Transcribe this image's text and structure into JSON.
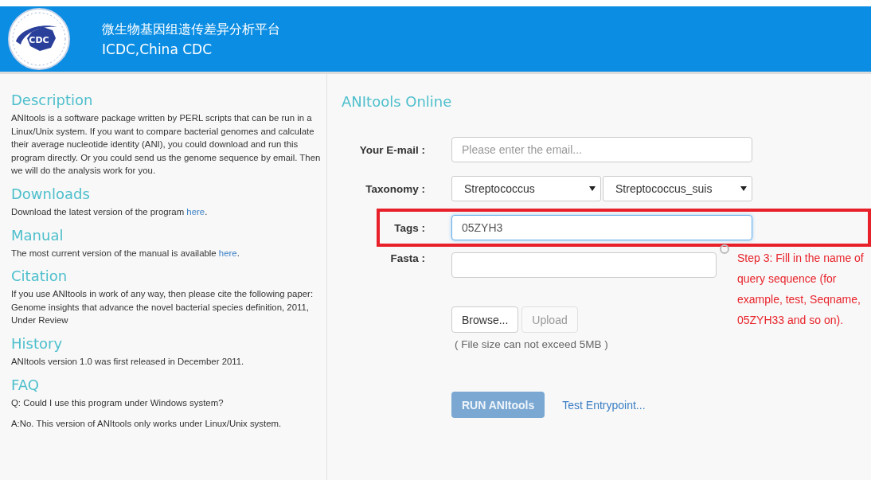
{
  "header": {
    "logo_text": "CDC",
    "title": "微生物基因组遗传差异分析平台",
    "subtitle": "ICDC,China CDC"
  },
  "sidebar": {
    "sections": [
      {
        "heading": "Description",
        "paragraphs": [
          {
            "text": "ANItools is a software package written by PERL scripts that can be run in a Linux/Unix system. If you want to compare bacterial genomes and calculate their average nucleotide identity (ANI), you could download and run this program directly. Or you could send us the genome sequence by email. Then we will do the analysis work for you."
          }
        ]
      },
      {
        "heading": "Downloads",
        "paragraphs": [
          {
            "text": "Download the latest version of the program ",
            "link": "here",
            "after": "."
          }
        ]
      },
      {
        "heading": "Manual",
        "paragraphs": [
          {
            "text": "The most current version of the manual is available ",
            "link": "here",
            "after": "."
          }
        ]
      },
      {
        "heading": "Citation",
        "paragraphs": [
          {
            "text": "If you use ANItools in work of any way, then please cite the following paper: Genome insights that advance the novel bacterial species definition, 2011, Under Review"
          }
        ]
      },
      {
        "heading": "History",
        "paragraphs": [
          {
            "text": "ANItools version 1.0 was first released in December 2011."
          }
        ]
      },
      {
        "heading": "FAQ",
        "paragraphs": [
          {
            "text": "Q: Could I use this program under Windows system?"
          },
          {
            "text": "A:No. This version of ANItools only works under Linux/Unix system."
          }
        ]
      }
    ]
  },
  "form": {
    "title": "ANItools Online",
    "email": {
      "label": "Your E-mail :",
      "placeholder": "Please enter the email..."
    },
    "taxonomy": {
      "label": "Taxonomy :",
      "genus": "Streptococcus",
      "species": "Streptococcus_suis"
    },
    "tags": {
      "label": "Tags :",
      "value": "05ZYH3",
      "highlighted": true
    },
    "fasta": {
      "label": "Fasta :"
    },
    "browse_button": "Browse...",
    "upload_button": {
      "label": "Upload",
      "disabled": true
    },
    "file_hint": "( File size can not exceed 5MB )",
    "run_button": {
      "label": "RUN ANItools",
      "disabled": true
    },
    "test_link": "Test Entrypoint..."
  },
  "annotation": {
    "text": "Step 3:  Fill in the name of query sequence (for example, test, Seqname, 05ZYH33 and so on)."
  }
}
